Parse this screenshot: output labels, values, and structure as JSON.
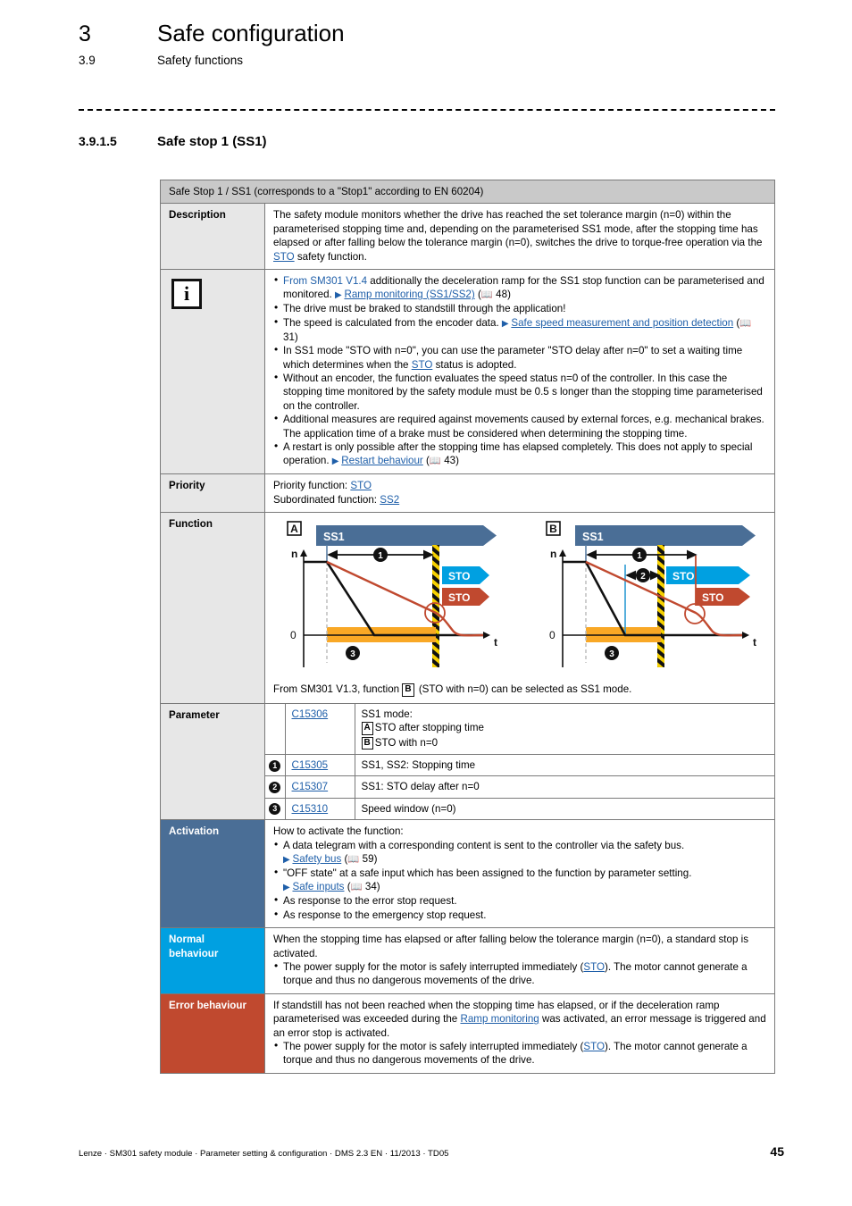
{
  "header": {
    "chapter_num": "3",
    "chapter_title": "Safe configuration",
    "section_num": "3.9",
    "section_title": "Safety functions",
    "subsection_num": "3.9.1.5",
    "subsection_title": "Safe stop 1 (SS1)"
  },
  "table": {
    "title_prefix": "S",
    "title": "afe ",
    "title_full": "Safe Stop 1 / SS1 (corresponds to a \"Stop1\" according to EN 60204)",
    "rows": {
      "description": {
        "label": "Description",
        "text": "The safety module monitors whether the drive has reached the set tolerance margin (n=0) within the parameterised stopping time and, depending on the parameterised SS1 mode, after the stopping time has elapsed or after falling below the tolerance margin (n=0), switches the drive to torque-free operation via the ",
        "link": "STO",
        "text_end": " safety function."
      },
      "notes": {
        "icon": "info-icon",
        "items": [
          {
            "pre_colored": "From SM301 V1.4",
            "text": " additionally the deceleration ramp for the SS1 stop function can be parameterised and monitored. ",
            "xref": "Ramp monitoring (SS1/SS2)",
            "xref_page": "48"
          },
          {
            "text": "The drive must be braked to standstill through the application!"
          },
          {
            "text": "The speed is calculated from the encoder data. ",
            "xref": "Safe speed measurement and position detection",
            "xref_page": "31"
          },
          {
            "text": "In SS1 mode \"STO with n=0\", you can use the parameter \"STO delay after n=0\" to set a waiting time which determines when the ",
            "inline_link": "STO",
            "text_end": " status is adopted."
          },
          {
            "text": "Without an encoder, the function evaluates the speed status n=0 of the controller. In this case the stopping time monitored by the safety module must be 0.5 s longer than the stopping time parameterised on the controller."
          },
          {
            "text": "Additional measures are required against movements caused by external forces, e.g. mechanical brakes. The application time of a brake must be considered when determining the stopping time."
          },
          {
            "text": "A restart is only possible after the stopping time has elapsed completely. This does not apply to special operation. ",
            "xref": "Restart behaviour",
            "xref_page": "43"
          }
        ]
      },
      "priority": {
        "label": "Priority",
        "line1_label": "Priority function: ",
        "line1_link": "STO",
        "line2_label": "Subordinated function: ",
        "line2_link": "SS2"
      },
      "function": {
        "label": "Function",
        "caption_pre": "From SM301 V1.3, function ",
        "caption_box": "B",
        "caption_post": " (STO with n=0) can be selected as SS1 mode."
      },
      "parameter": {
        "label": "Parameter",
        "rows": [
          {
            "marker": "",
            "code": "C15306",
            "desc_lines": [
              "SS1 mode:"
            ],
            "desc_a_box": "A",
            "desc_a": "STO after stopping time",
            "desc_b_box": "B",
            "desc_b": "STO with n=0"
          },
          {
            "marker": "1",
            "code": "C15305",
            "desc": "SS1, SS2: Stopping time"
          },
          {
            "marker": "2",
            "code": "C15307",
            "desc": "SS1: STO delay after n=0"
          },
          {
            "marker": "3",
            "code": "C15310",
            "desc": "Speed window (n=0)"
          }
        ]
      },
      "activation": {
        "label": "Activation",
        "intro": "How to activate the function:",
        "items": [
          {
            "text": "A data telegram with a corresponding content is sent to the controller via the safety bus.",
            "xref": "Safety bus",
            "xref_page": "59"
          },
          {
            "text": "\"OFF state\" at a safe input which has been assigned to the function by parameter setting.",
            "xref": "Safe inputs",
            "xref_page": "34"
          },
          {
            "text": "As response to the error stop request."
          },
          {
            "text": "As response to the emergency stop request."
          }
        ]
      },
      "normal": {
        "label_line1": "Normal",
        "label_line2": "behaviour",
        "text": "When the stopping time has elapsed or after falling below the tolerance margin (n=0), a standard stop is activated.",
        "bullet_pre": "The power supply for the motor is safely interrupted immediately (",
        "bullet_link": "STO",
        "bullet_post": "). The motor cannot generate a torque and thus no dangerous movements of the drive."
      },
      "error": {
        "label": "Error behaviour",
        "text_pre": "If standstill has not been reached when the stopping time has elapsed, or if the deceleration ramp parameterised was exceeded during the ",
        "text_link": "Ramp monitoring",
        "text_post": " was activated, an error message is triggered and an error stop is activated.",
        "bullet_pre": "The power supply for the motor is safely interrupted immediately (",
        "bullet_link": "STO",
        "bullet_post": "). The motor cannot generate a torque and thus no dangerous movements of the drive."
      }
    }
  },
  "diagram": {
    "panel_a": {
      "letter": "A",
      "ss1_label": "SS1",
      "sto_cyan_label": "STO",
      "sto_red_label": "STO",
      "y_axis_top": "n",
      "y_axis_zero": "0",
      "x_axis": "t",
      "marker_1": "1",
      "marker_3": "3"
    },
    "panel_b": {
      "letter": "B",
      "ss1_label": "SS1",
      "sto_cyan_label": "STO",
      "sto_red_label": "STO",
      "y_axis_top": "n",
      "y_axis_zero": "0",
      "x_axis": "t",
      "marker_1": "1",
      "marker_2": "2",
      "marker_3": "3"
    }
  },
  "colors": {
    "steel_blue": "#4a6e96",
    "cyan": "#00a0e1",
    "red": "#c0492f",
    "orange": "#f9a825",
    "link_blue": "#1f5fa9",
    "header_gray": "#c9c9c9",
    "label_gray": "#e7e7e7"
  },
  "footer": {
    "text": "Lenze · SM301 safety module · Parameter setting & configuration · DMS 2.3 EN · 11/2013 · TD05",
    "page": "45"
  }
}
